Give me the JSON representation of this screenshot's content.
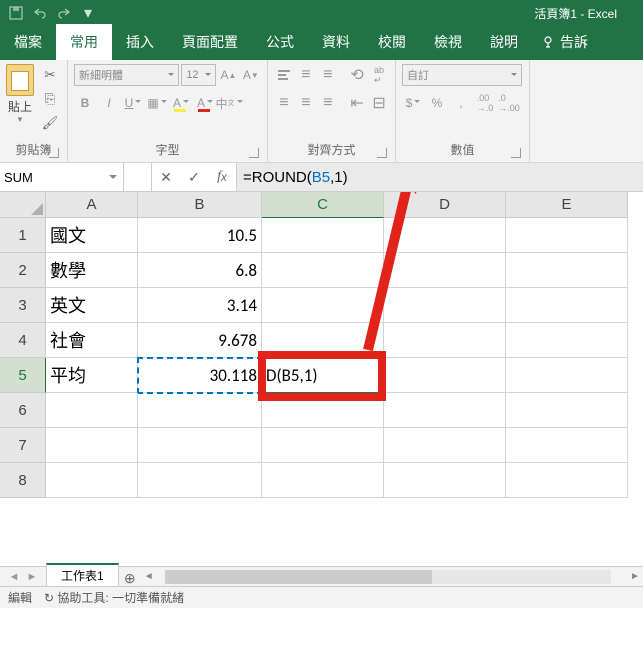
{
  "title": "活頁簿1 - Excel",
  "tabs": {
    "file": "檔案",
    "home": "常用",
    "insert": "插入",
    "layout": "頁面配置",
    "formulas": "公式",
    "data": "資料",
    "review": "校閱",
    "view": "檢視",
    "help": "說明",
    "tell": "告訴"
  },
  "ribbon": {
    "clipboard": {
      "paste": "貼上",
      "label": "剪貼簿"
    },
    "font": {
      "name": "新細明體",
      "size": "12",
      "label": "字型"
    },
    "align": {
      "label": "對齊方式"
    },
    "number": {
      "format": "自訂",
      "label": "數值"
    }
  },
  "nameBox": "SUM",
  "formula": {
    "pre": "=ROUND(",
    "ref": "B5",
    "post": ",1)"
  },
  "columns": [
    "A",
    "B",
    "C",
    "D",
    "E"
  ],
  "rows": [
    "1",
    "2",
    "3",
    "4",
    "5",
    "6",
    "7",
    "8"
  ],
  "cells": {
    "A1": "國文",
    "B1": "10.5",
    "A2": "數學",
    "B2": "6.8",
    "A3": "英文",
    "B3": "3.14",
    "A4": "社會",
    "B4": "9.678",
    "A5": "平均",
    "B5": "30.118",
    "C5": "D(B5,1)"
  },
  "sheet": {
    "name": "工作表1"
  },
  "status": {
    "mode": "編輯",
    "acc": "協助工具: 一切準備就緒"
  }
}
